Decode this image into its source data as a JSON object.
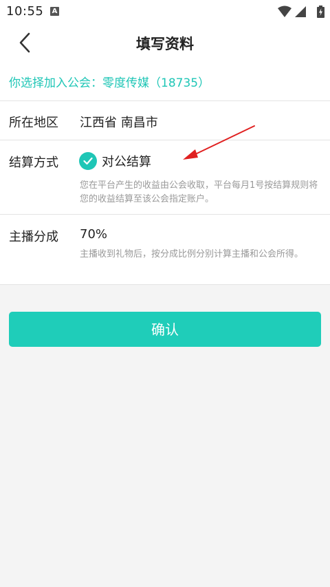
{
  "status_bar": {
    "time": "10:55",
    "notification_letter": "A",
    "icons": [
      "wifi-icon",
      "cellular-signal-icon",
      "battery-charging-icon"
    ]
  },
  "header": {
    "title": "填写资料",
    "back_icon": "chevron-left-icon"
  },
  "guild_tip": {
    "text": "你选择加入公会：零度传媒（18735）"
  },
  "form": {
    "region": {
      "label": "所在地区",
      "value": "江西省 南昌市"
    },
    "settlement": {
      "label": "结算方式",
      "value": "对公结算",
      "checked": true,
      "description": "您在平台产生的收益由公会收取，平台每月1号按结算规则将您的收益结算至该公会指定账户。"
    },
    "revenue_share": {
      "label": "主播分成",
      "value": "70%",
      "description": "主播收到礼物后，按分成比例分别计算主播和公会所得。"
    }
  },
  "actions": {
    "confirm_label": "确认"
  },
  "colors": {
    "accent": "#1fc6b6",
    "button": "#1fcdb9",
    "annotation_arrow": "#e02020"
  }
}
